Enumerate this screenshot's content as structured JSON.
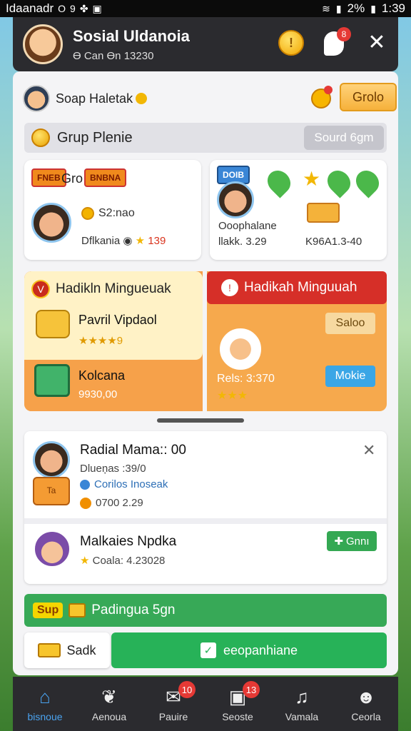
{
  "status_bar": {
    "carrier": "Idaanadr",
    "battery": "2%",
    "time": "1:39",
    "app_glyph": "O",
    "num_glyph": "9"
  },
  "header": {
    "title": "Sosial Uldanoia",
    "subtitle": "Ɵ Can Ɵn 13230",
    "coin_glyph": "!",
    "badge": "8"
  },
  "user": {
    "name": "Soap Haletak",
    "button": "Grolo"
  },
  "section": {
    "title": "Grup Plenie",
    "button": "Sourd 6gm"
  },
  "card_left": {
    "badge1": "FNEB",
    "label": "Gro",
    "badge2": "BNBNA",
    "coins": "S2:nao",
    "meta_name": "Dflkania",
    "meta_value": "139"
  },
  "card_right": {
    "badge": "DOIB",
    "line1": "Ooophalane",
    "line2": "llakk. 3.29",
    "line3": "K96A1.3-40"
  },
  "promo_left": {
    "title": "Hadikln Mingueuak",
    "item1_title": "Pavril Vipdaol",
    "item1_rating": "★★★★9",
    "item2_title": "Kolcana",
    "item2_value": "9930,00"
  },
  "promo_right": {
    "title": "Hadikah Minguuah",
    "btn_top": "Saloo",
    "price": "Rels: 3:370",
    "rating": "★★★",
    "btn_bottom": "Mokie"
  },
  "list": [
    {
      "title": "Radial Mama:: 00",
      "sub1": "Dlueņas :39/0",
      "sub2": "Corilos Inoseak",
      "sub3": "0700 2.29",
      "box_text": "Ta"
    },
    {
      "title": "Malkaies Npdka",
      "sub1": "Coala: 4.23028",
      "button": "Gnnı"
    }
  ],
  "green_bar": {
    "tag": "Sup",
    "text": "Padingua 5gn"
  },
  "actions": {
    "left": "Sadk",
    "right": "eeopanhiane"
  },
  "nav": [
    {
      "label": "bisnoue",
      "icon": "home-icon",
      "badge": ""
    },
    {
      "label": "Aenoua",
      "icon": "leaf-icon",
      "badge": ""
    },
    {
      "label": "Pauire",
      "icon": "message-icon",
      "badge": "10"
    },
    {
      "label": "Seoste",
      "icon": "inbox-icon",
      "badge": "13"
    },
    {
      "label": "Vamala",
      "icon": "music-icon",
      "badge": ""
    },
    {
      "label": "Ceorla",
      "icon": "person-icon",
      "badge": ""
    }
  ],
  "colors": {
    "accent_blue": "#4aa3f0",
    "green": "#27b258",
    "red": "#d62f28",
    "orange": "#f6a14a",
    "dark": "#2b2b2f"
  }
}
